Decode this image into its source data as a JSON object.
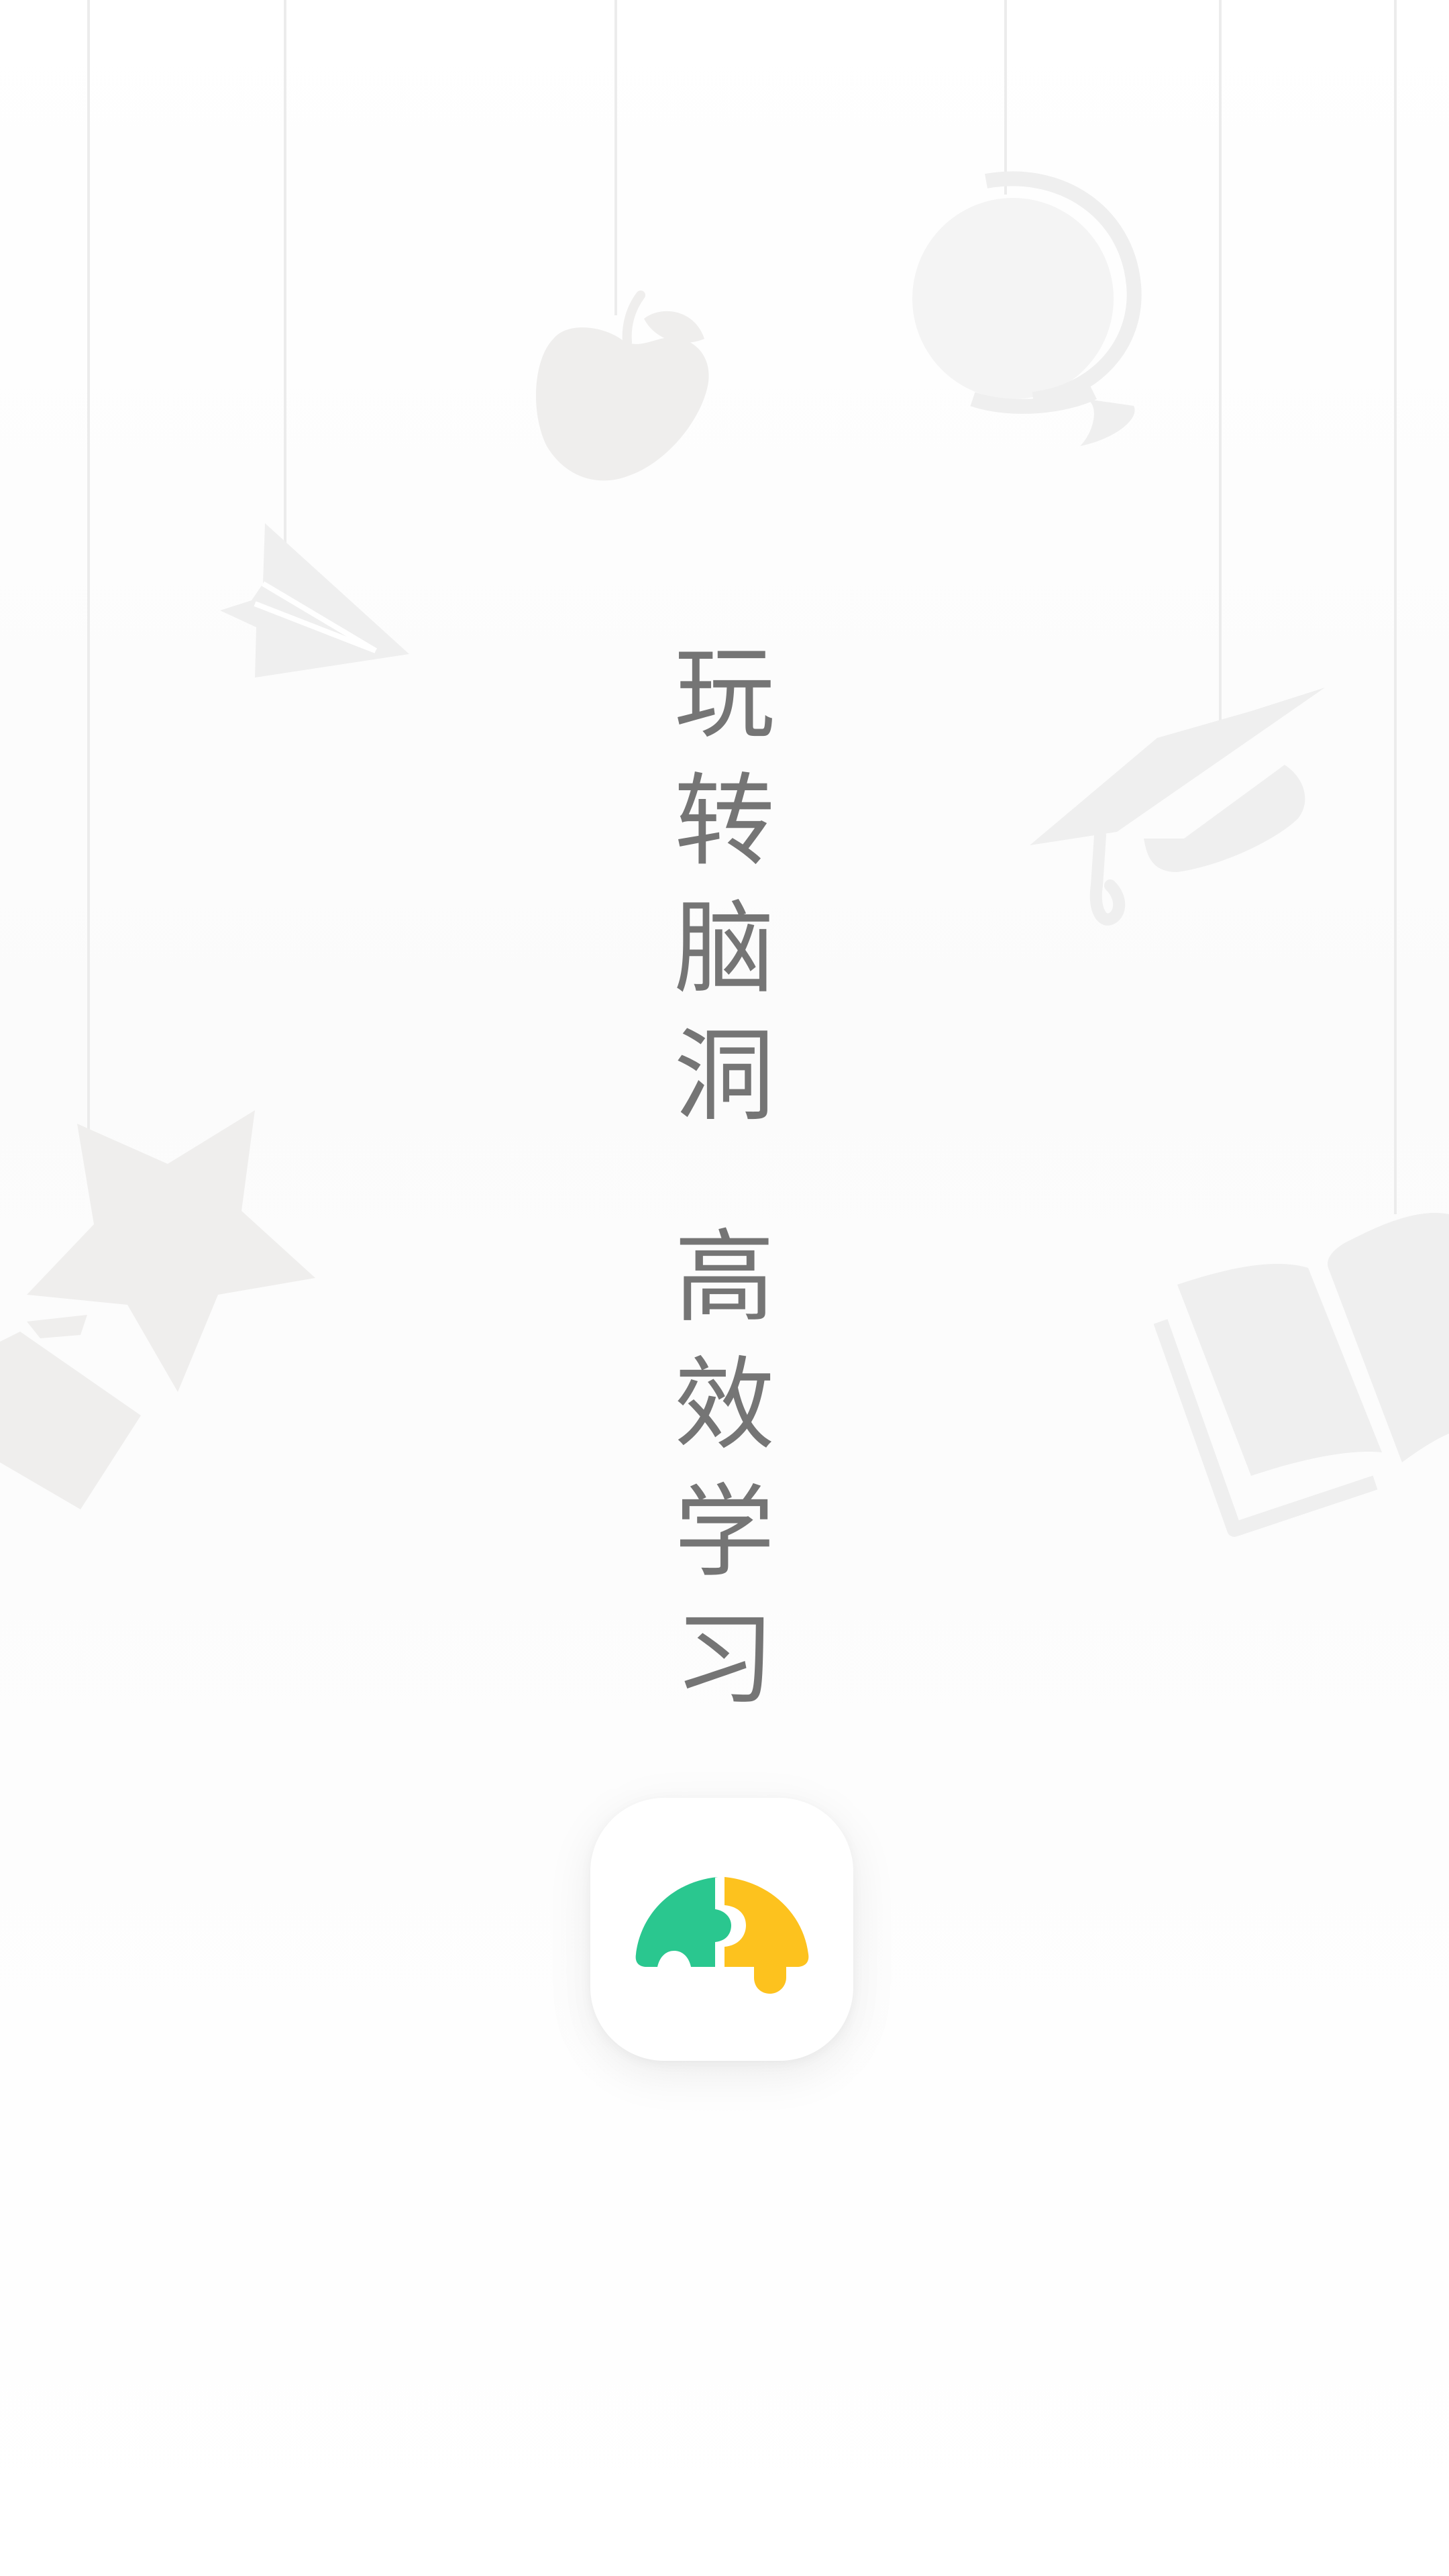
{
  "splash": {
    "slogan_line1": [
      "玩",
      "转",
      "脑",
      "洞"
    ],
    "slogan_line2": [
      "高",
      "效",
      "学",
      "习"
    ]
  },
  "logo": {
    "name": "puzzle-turtle-logo",
    "colors": {
      "green": "#2AC78F",
      "yellow": "#FDC21E"
    }
  },
  "decorations": [
    "paper-plane-icon",
    "apple-icon",
    "globe-icon",
    "graduation-cap-icon",
    "star-icon",
    "pencil-icon",
    "open-book-icon"
  ],
  "colors": {
    "text": "#757575",
    "string": "#ececec",
    "decor": "#efefef",
    "background": "#ffffff"
  }
}
